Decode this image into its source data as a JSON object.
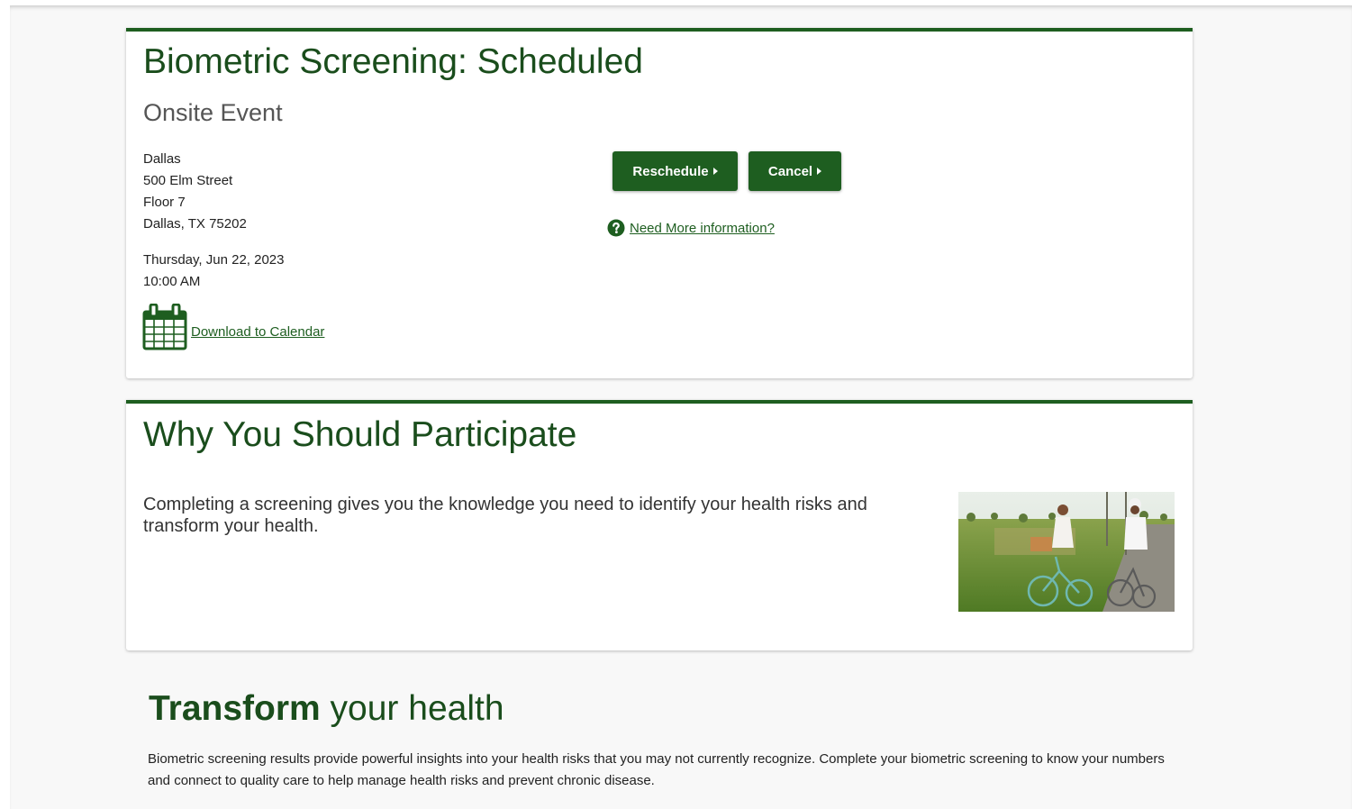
{
  "screening": {
    "title": "Biometric Screening: Scheduled",
    "subtitle": "Onsite Event",
    "address": [
      "Dallas",
      "500 Elm Street",
      "Floor 7",
      "Dallas, TX 75202"
    ],
    "date": "Thursday, Jun 22, 2023",
    "time": "10:00 AM",
    "calendar_link": "Download to Calendar",
    "reschedule_label": "Reschedule",
    "cancel_label": "Cancel",
    "info_link": "Need More information?"
  },
  "why": {
    "title": "Why You Should Participate",
    "text": "Completing a screening gives you the knowledge you need to identify your health risks and transform your health."
  },
  "transform": {
    "title_bold": "Transform",
    "title_rest": " your health",
    "text": "Biometric screening results provide powerful insights into your health risks that you may not currently recognize. Complete your biometric screening to know your numbers and connect to quality care to help manage health risks and prevent chronic disease."
  },
  "colors": {
    "brand_green": "#1e5e20",
    "title_green": "#1a4d1c"
  },
  "icons": {
    "calendar": "calendar-icon",
    "help": "question-circle-icon",
    "caret": "caret-right-icon"
  }
}
